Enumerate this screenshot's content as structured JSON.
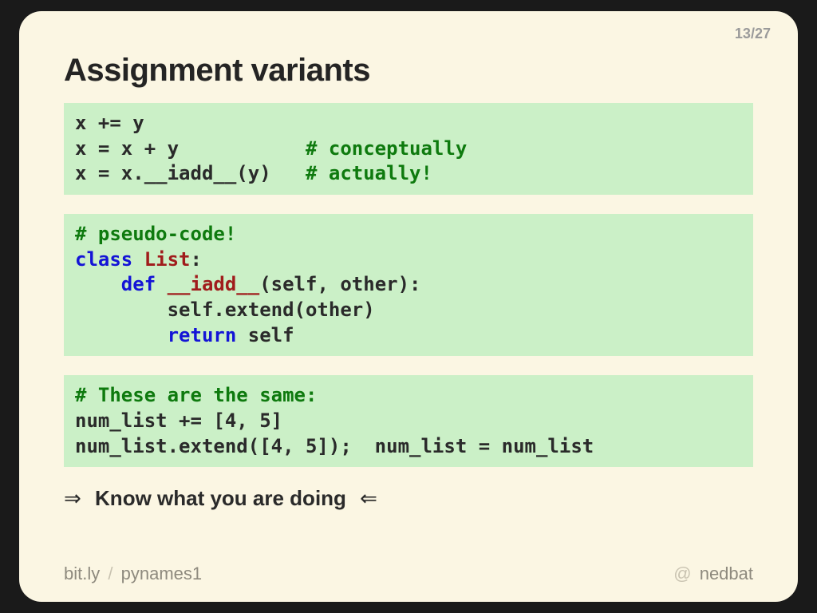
{
  "page": {
    "current": "13",
    "total": "27"
  },
  "title": "Assignment variants",
  "codeblocks": [
    {
      "id": "block1",
      "tokens": [
        {
          "t": "tok",
          "s": "x += y"
        },
        {
          "t": "br"
        },
        {
          "t": "tok",
          "s": "x = x + y           "
        },
        {
          "t": "tok-cm",
          "s": "# conceptually"
        },
        {
          "t": "br"
        },
        {
          "t": "tok",
          "s": "x = x.__iadd__(y)   "
        },
        {
          "t": "tok-cm",
          "s": "# actually!"
        }
      ]
    },
    {
      "id": "block2",
      "tokens": [
        {
          "t": "tok-cm",
          "s": "# pseudo-code!"
        },
        {
          "t": "br"
        },
        {
          "t": "tok-kw",
          "s": "class"
        },
        {
          "t": "tok",
          "s": " "
        },
        {
          "t": "tok-cl",
          "s": "List"
        },
        {
          "t": "tok",
          "s": ":"
        },
        {
          "t": "br"
        },
        {
          "t": "tok",
          "s": "    "
        },
        {
          "t": "tok-kw",
          "s": "def"
        },
        {
          "t": "tok",
          "s": " "
        },
        {
          "t": "tok-fn",
          "s": "__iadd__"
        },
        {
          "t": "tok",
          "s": "(self, other):"
        },
        {
          "t": "br"
        },
        {
          "t": "tok",
          "s": "        self.extend(other)"
        },
        {
          "t": "br"
        },
        {
          "t": "tok",
          "s": "        "
        },
        {
          "t": "tok-kw",
          "s": "return"
        },
        {
          "t": "tok",
          "s": " self"
        }
      ]
    },
    {
      "id": "block3",
      "tokens": [
        {
          "t": "tok-cm",
          "s": "# These are the same:"
        },
        {
          "t": "br"
        },
        {
          "t": "tok",
          "s": "num_list += [4, 5]"
        },
        {
          "t": "br"
        },
        {
          "t": "tok",
          "s": "num_list.extend([4, 5]);  num_list = num_list"
        }
      ]
    }
  ],
  "callout": {
    "left_arrow": "⇒",
    "message": "Know what you are doing",
    "right_arrow": "⇐"
  },
  "footer": {
    "link_domain": "bit.ly",
    "link_sep": "/",
    "link_path": "pynames1",
    "handle_at": "@",
    "handle_name": "nedbat"
  }
}
